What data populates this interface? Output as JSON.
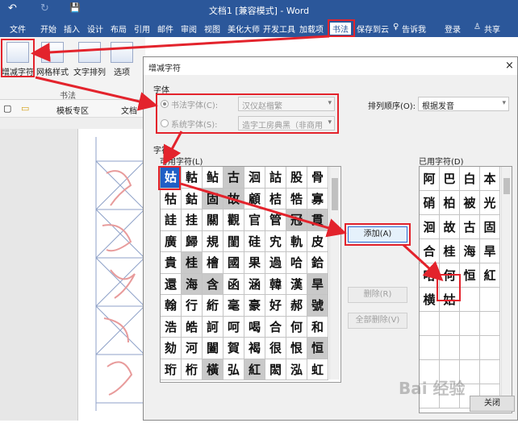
{
  "word": {
    "title": "文档1 [兼容模式] - Word",
    "quick_access": [
      "↶",
      "↻",
      "💾"
    ],
    "menu_tabs": [
      "文件",
      "开始",
      "插入",
      "设计",
      "布局",
      "引用",
      "邮件",
      "审阅",
      "视图",
      "美化大师",
      "开发工具",
      "加载项",
      "书法",
      "保存到云"
    ],
    "search_hint": "告诉我",
    "login": "登录",
    "share": "共享",
    "ribbon_buttons": [
      "增减字符",
      "网格样式",
      "文字排列",
      "选项"
    ],
    "ribbon_group": "书法",
    "doc_tabs": [
      "模板专区",
      "文档"
    ]
  },
  "dialog": {
    "title": "增减字符",
    "close_glyph": "×",
    "font_section": "字体",
    "calligraphy_radio": "书法字体(C):",
    "calligraphy_value": "汉仪赵楷繁",
    "system_radio": "系统字体(S):",
    "system_value": "造字工房典黑（非商用",
    "sort_label": "排列顺序(O):",
    "sort_value": "根据发音",
    "chars_section": "字符",
    "available_label": "可用字符(L)",
    "used_label": "已用字符(D)",
    "available_chars": [
      [
        "姑",
        "軲",
        "鲇",
        "古",
        "洄",
        "詁",
        "股",
        "骨"
      ],
      [
        "牯",
        "鈷",
        "固",
        "故",
        "顧",
        "桔",
        "牿",
        "寡"
      ],
      [
        "詿",
        "挂",
        "關",
        "觀",
        "官",
        "管",
        "冠",
        "貫"
      ],
      [
        "廣",
        "歸",
        "規",
        "閨",
        "硅",
        "宄",
        "軌",
        "皮"
      ],
      [
        "貴",
        "桂",
        "檜",
        "國",
        "果",
        "過",
        "哈",
        "鉿"
      ],
      [
        "還",
        "海",
        "含",
        "函",
        "涵",
        "韓",
        "漢",
        "旱"
      ],
      [
        "翰",
        "行",
        "絎",
        "毫",
        "豪",
        "好",
        "郝",
        "號"
      ],
      [
        "浩",
        "皓",
        "訶",
        "呵",
        "喝",
        "合",
        "何",
        "和"
      ],
      [
        "劾",
        "河",
        "闔",
        "賀",
        "褐",
        "很",
        "恨",
        "恒"
      ],
      [
        "珩",
        "桁",
        "橫",
        "弘",
        "紅",
        "閎",
        "泓",
        "虹"
      ]
    ],
    "available_dark": [
      [
        0,
        3
      ],
      [
        1,
        2
      ],
      [
        1,
        3
      ],
      [
        2,
        6
      ],
      [
        2,
        7
      ],
      [
        4,
        1
      ],
      [
        5,
        1
      ],
      [
        5,
        2
      ],
      [
        5,
        7
      ],
      [
        6,
        7
      ],
      [
        8,
        7
      ],
      [
        9,
        2
      ],
      [
        9,
        4
      ]
    ],
    "used_chars": [
      [
        "阿",
        "巴",
        "白",
        "本"
      ],
      [
        "硝",
        "柏",
        "被",
        "光"
      ],
      [
        "洄",
        "故",
        "古",
        "固"
      ],
      [
        "合",
        "桂",
        "海",
        "旱"
      ],
      [
        "哈",
        "何",
        "恒",
        "紅"
      ],
      [
        "横",
        "姑",
        "",
        ""
      ],
      [
        "",
        "",
        "",
        ""
      ],
      [
        "",
        "",
        "",
        ""
      ],
      [
        "",
        "",
        "",
        ""
      ],
      [
        "",
        "",
        "",
        ""
      ]
    ],
    "add_button": "添加(A)",
    "delete_button": "删除(R)",
    "delete_all_button": "全部删除(V)",
    "close_button": "关闭"
  },
  "watermark": "Bai 经验"
}
